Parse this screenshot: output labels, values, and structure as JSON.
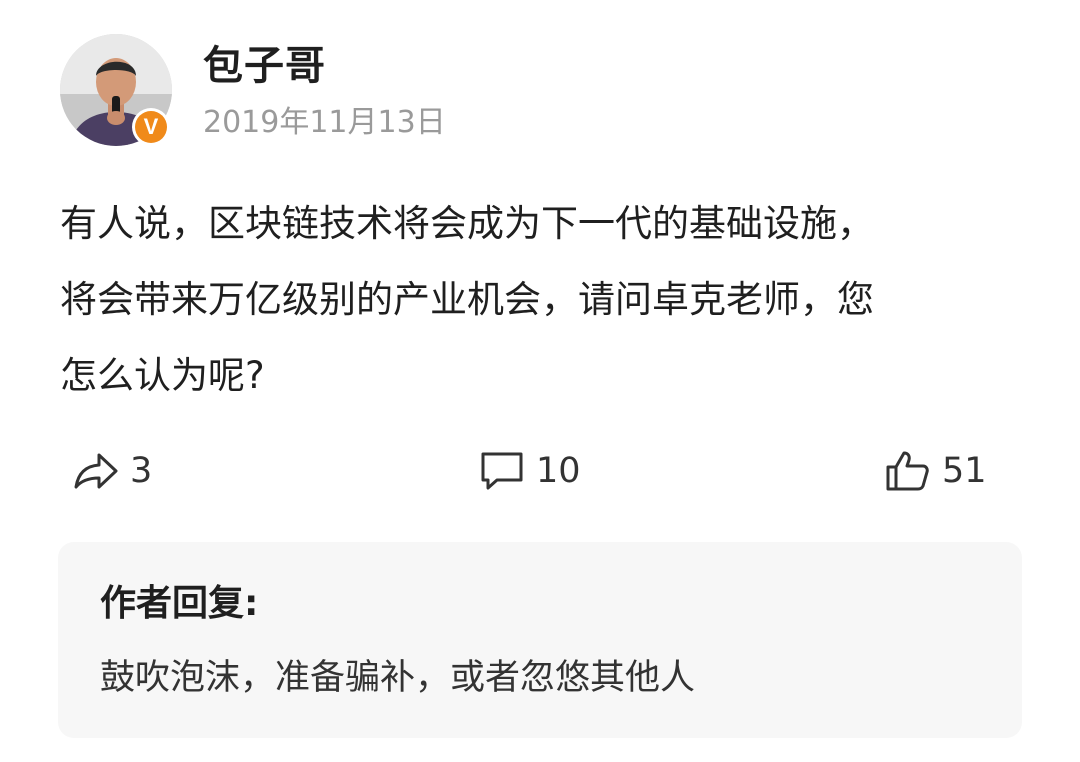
{
  "post": {
    "author": "包子哥",
    "date": "2019年11月13日",
    "verified_badge": "V",
    "text": "有人说，区块链技术将会成为下一代的基础设施，\n将会带来万亿级别的产业机会，请问卓克老师，您\n怎么认为呢?"
  },
  "actions": {
    "repost": {
      "icon": "share-arrow-icon",
      "count": "3"
    },
    "comment": {
      "icon": "comment-bubble-icon",
      "count": "10"
    },
    "like": {
      "icon": "thumbs-up-icon",
      "count": "51"
    }
  },
  "reply": {
    "title": "作者回复:",
    "text": "鼓吹泡沫，准备骗补，或者忽悠其他人"
  },
  "colors": {
    "badge": "#f08a1a",
    "date": "#9a9a9a",
    "reply_background": "#f7f7f7"
  }
}
